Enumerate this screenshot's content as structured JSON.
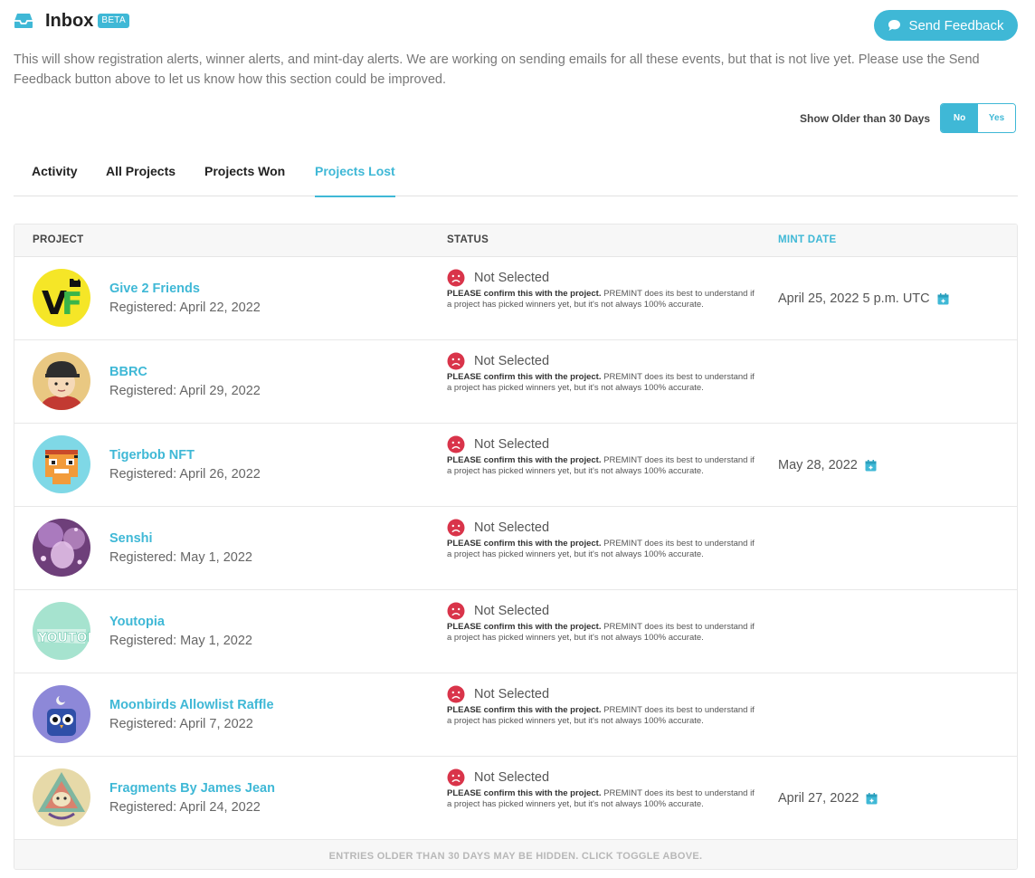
{
  "header": {
    "title": "Inbox",
    "badge": "BETA"
  },
  "feedback": {
    "label": "Send Feedback"
  },
  "intro": {
    "text": "This will show registration alerts, winner alerts, and mint-day alerts. We are working on sending emails for all these events, but that is not live yet. Please use the Send Feedback button above to let us know how this section could be improved."
  },
  "older_toggle": {
    "label": "Show Older than 30 Days",
    "no": "No",
    "yes": "Yes",
    "selected": "No"
  },
  "tabs": [
    {
      "label": "Activity"
    },
    {
      "label": "All Projects"
    },
    {
      "label": "Projects Won"
    },
    {
      "label": "Projects Lost",
      "active": true
    }
  ],
  "table": {
    "headers": {
      "project": "PROJECT",
      "status": "STATUS",
      "mint_date": "MINT DATE"
    },
    "status_bold": "PLEASE confirm this with the project.",
    "status_rest": " PREMINT does its best to understand if a project has picked winners yet, but it's not always 100% accurate.",
    "rows": [
      {
        "name": "Give 2 Friends",
        "registered": "Registered: April 22, 2022",
        "status": "Not Selected",
        "mint_date": "April 25, 2022 5 p.m. UTC"
      },
      {
        "name": "BBRC",
        "registered": "Registered: April 29, 2022",
        "status": "Not Selected",
        "mint_date": ""
      },
      {
        "name": "Tigerbob NFT",
        "registered": "Registered: April 26, 2022",
        "status": "Not Selected",
        "mint_date": "May 28, 2022"
      },
      {
        "name": "Senshi",
        "registered": "Registered: May 1, 2022",
        "status": "Not Selected",
        "mint_date": ""
      },
      {
        "name": "Youtopia",
        "registered": "Registered: May 1, 2022",
        "status": "Not Selected",
        "mint_date": ""
      },
      {
        "name": "Moonbirds Allowlist Raffle",
        "registered": "Registered: April 7, 2022",
        "status": "Not Selected",
        "mint_date": ""
      },
      {
        "name": "Fragments By James Jean",
        "registered": "Registered: April 24, 2022",
        "status": "Not Selected",
        "mint_date": "April 27, 2022"
      }
    ],
    "footer": "ENTRIES OLDER THAN 30 DAYS MAY BE HIDDEN. CLICK TOGGLE ABOVE."
  },
  "colors": {
    "accent": "#3fb8d6",
    "sad": "#d9344a"
  },
  "icons": {
    "inbox": "inbox-icon",
    "feedback": "chat-bubble-icon",
    "status": "sad-face-icon",
    "calendar": "calendar-icon"
  }
}
